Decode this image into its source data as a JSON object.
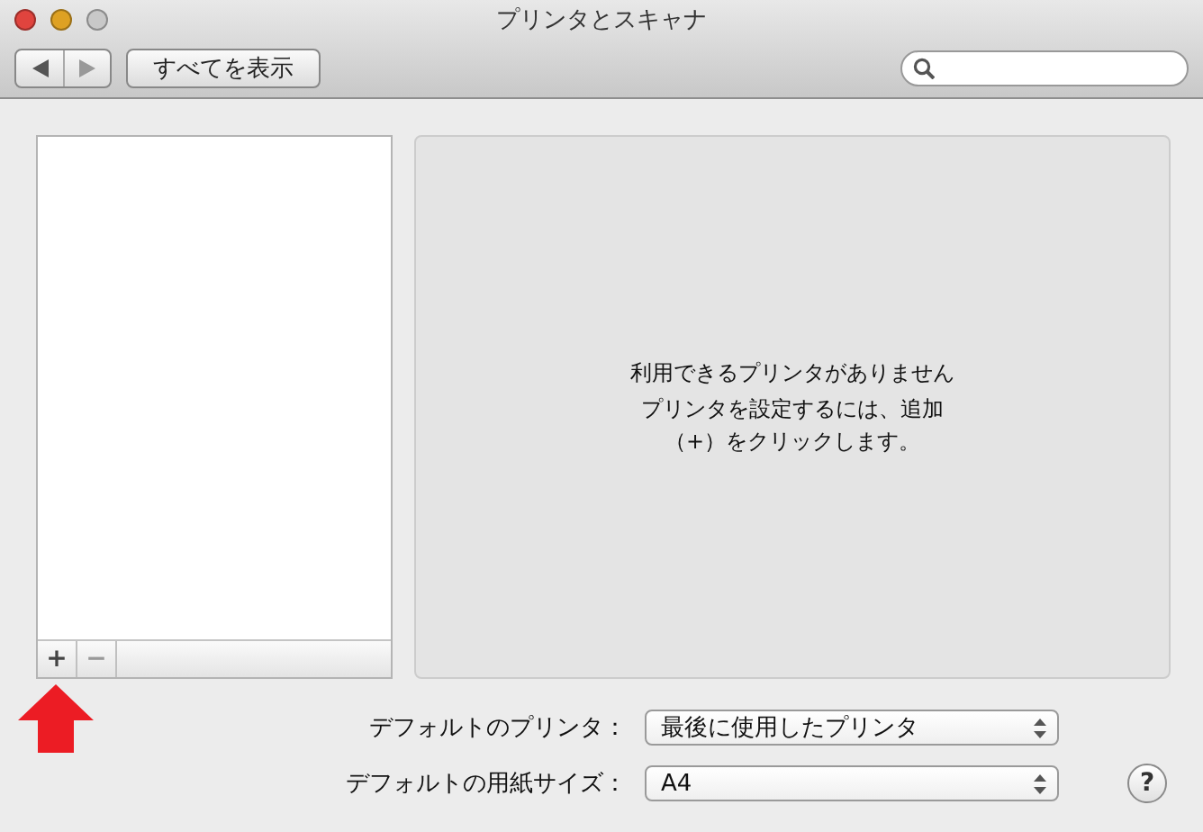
{
  "window": {
    "title": "プリンタとスキャナ"
  },
  "toolbar": {
    "show_all_button": "すべてを表示"
  },
  "printer_list": {
    "add_button": "+",
    "remove_button": "−"
  },
  "message": {
    "title": "利用できるプリンタがありません",
    "body": "プリンタを設定するには、追加（+）をクリックします。"
  },
  "settings": [
    {
      "label": "デフォルトのプリンタ：",
      "value": "最後に使用したプリンタ"
    },
    {
      "label": "デフォルトの用紙サイズ：",
      "value": "A4"
    }
  ],
  "help_button": "?"
}
